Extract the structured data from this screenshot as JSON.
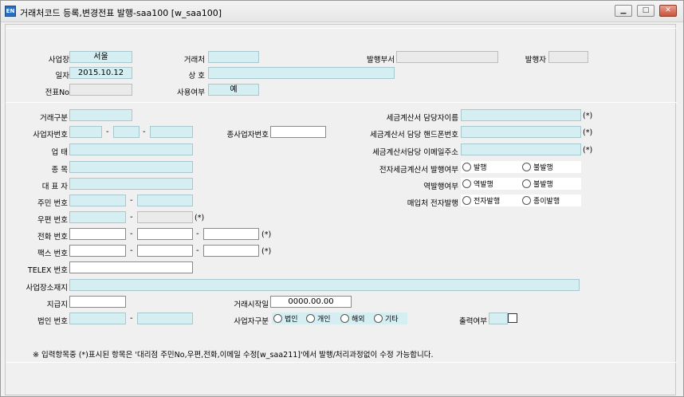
{
  "window": {
    "title": "거래처코드 등록,변경전표 발행-saa100 [w_saa100]",
    "icon_text": "EN",
    "min_glyph": "▁",
    "max_glyph": "□",
    "close_glyph": "✕"
  },
  "header": {
    "branch_label": "사업장",
    "branch_value": "서울",
    "client_label": "거래처",
    "client_value": "",
    "issue_dept_label": "발행부서",
    "issue_dept_value": "",
    "issuer_label": "발행자",
    "issuer_value": "",
    "date_label": "일자",
    "date_value": "2015.10.12",
    "trade_name_label": "상 호",
    "trade_name_value": "",
    "slip_no_label": "전표No",
    "slip_no_value": "",
    "use_label": "사용여부",
    "use_value": "예"
  },
  "form": {
    "trade_type_label": "거래구분",
    "bizno_label": "사업자번호",
    "sub_bizno_label": "종사업자번호",
    "business_label": "업 태",
    "item_label": "종 목",
    "ceo_label": "대 표 자",
    "resident_label": "주민 번호",
    "zip_label": "우편 번호",
    "zip_required": "(*)",
    "phone_label": "전화 번호",
    "phone_required": "(*)",
    "fax_label": "팩스 번호",
    "fax_required": "(*)",
    "telex_label": "TELEX 번호",
    "address_label": "사업장소재지",
    "payment_label": "지급지",
    "start_date_label": "거래시작일",
    "start_date_value": "0000.00.00",
    "corp_no_label": "법인 번호",
    "biz_type_label": "사업자구분",
    "biz_type_options": [
      "법인",
      "개인",
      "해외",
      "기타"
    ],
    "print_label": "출력여부",
    "tax_manager_label": "세금계산서 담당자이름",
    "tax_manager_required": "(*)",
    "tax_phone_label": "세금계산서 담당 핸드폰번호",
    "tax_phone_required": "(*)",
    "tax_email_label": "세금계산서담당 이메일주소",
    "tax_email_required": "(*)",
    "e_tax_label": "전자세금계산서 발행여부",
    "e_tax_options": [
      "발행",
      "불발행"
    ],
    "reverse_label": "역발행여부",
    "reverse_options": [
      "역발행",
      "불발행"
    ],
    "purchase_label": "매입처 전자발행",
    "purchase_options": [
      "전자발행",
      "종이발행"
    ],
    "dash": "-"
  },
  "footer": {
    "note": "※ 입력항목중 (*)표시된 항목은 '대리점 주민No,우편,전화,이메일 수정[w_saa211]'에서 발행/처리과정없이 수정 가능합니다."
  }
}
